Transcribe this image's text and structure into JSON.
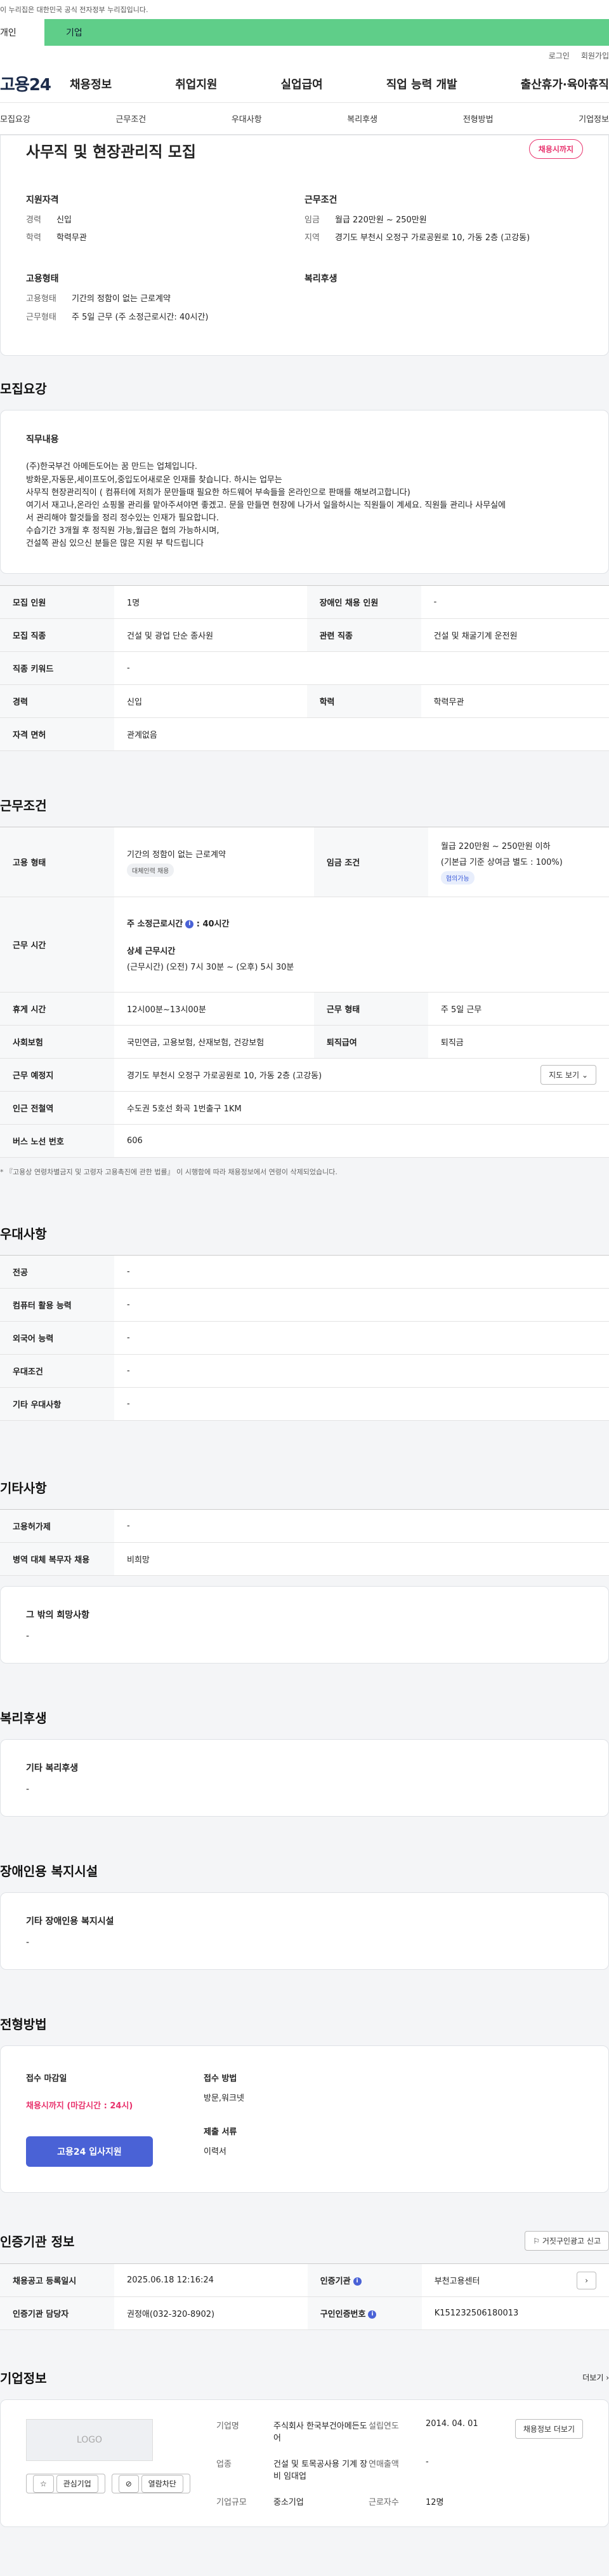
{
  "banner": "이 누리집은 대한민국 공식 전자정부 누리집입니다.",
  "tabs": [
    "개인",
    "기업"
  ],
  "util": [
    "로그인",
    "회원가입"
  ],
  "logo": "고용24",
  "gnb": [
    "채용정보",
    "취업지원",
    "실업급여",
    "직업 능력 개발",
    "출산휴가·육아휴직"
  ],
  "subnav": [
    "모집요강",
    "근무조건",
    "우대사항",
    "복리후생",
    "전형방법",
    "기업정보"
  ],
  "hero": {
    "title": "사무직 및 현장관리직 모집",
    "status": "채용시까지",
    "qual_title": "지원자격",
    "qual": [
      {
        "k": "경력",
        "v": "신입"
      },
      {
        "k": "학력",
        "v": "학력무관"
      }
    ],
    "cond_title": "근무조건",
    "cond": [
      {
        "k": "임금",
        "v": "월급 220만원 ~ 250만원"
      },
      {
        "k": "지역",
        "v": "경기도 부천시 오정구 가로공원로 10, 가동 2층 (고강동)"
      }
    ],
    "emp_title": "고용형태",
    "emp": [
      {
        "k": "고용형태",
        "v": "기간의 정함이 없는 근로계약"
      },
      {
        "k": "근무형태",
        "v": "주 5일 근무 (주 소정근로시간: 40시간)"
      }
    ],
    "welfare_title": "복리후생"
  },
  "recruit": {
    "title": "모집요강",
    "duty_title": "직무내용",
    "duty_lines": [
      "(주)한국부건 아메든도어는 꿈 만드는 업체입니다.",
      "방화문,자동문,세이프도어,중입도어새로운 인재를 찾습니다. 하시는 업무는",
      "사무직 현장관리직이 ( 컴퓨터에 저희가 문만들때 필요한 하드웨어 부속들을 온라인으로 판매를 해보려고합니다)",
      "여기서 재고나,온라인 쇼핑몰 관리를 맡아주셔야면 좋겠고. 문을 만들면 현장에 나가서 일을하시는 직원들이 계세요. 직원들 관리나 사무실에",
      "서 관리해야 할것들을 정리 정수있는 인재가 필요합니다.",
      "수습기간 3개월 후 정직원 가능,월급은 협의 가능하시며,",
      "건설쪽 관심 있으신 분들은 많은 지원 부 탁드립니다"
    ],
    "rows": [
      {
        "h1": "모집 인원",
        "v1": "1명",
        "h2": "장애인 채용 인원",
        "v2": "-"
      },
      {
        "h1": "모집 직종",
        "v1": "건설 및 광업 단순 종사원",
        "h2": "관련 직종",
        "v2": "건설 및 채굴기계 운전원"
      },
      {
        "h1": "직종 키워드",
        "v1": "-"
      },
      {
        "h1": "경력",
        "v1": "신입",
        "h2": "학력",
        "v2": "학력무관"
      },
      {
        "h1": "자격 면허",
        "v1": "관계없음"
      }
    ]
  },
  "work": {
    "title": "근무조건",
    "emp_h": "고용 형태",
    "emp_v": "기간의 정함이 없는 근로계약",
    "emp_pill": "대체인력 채용",
    "wage_h": "임금 조건",
    "wage_v": "월급 220만원 ~ 250만원 이하",
    "wage_sub": "(기본급 기준 상여금 별도 : 100%)",
    "wage_pill": "협의가능",
    "time_h": "근무 시간",
    "time_main": "주 소정근로시간",
    "time_main_v": ": 40시간",
    "time_detail_title": "상세 근무시간",
    "time_detail": "(근무시간) (오전) 7시 30분 ~ (오후) 5시 30분",
    "rest_h": "휴게 시간",
    "rest_v": "12시00분~13시00분",
    "form_h": "근무 형태",
    "form_v": "주 5일 근무",
    "ins_h": "사회보험",
    "ins_v": "국민연금, 고용보험, 산재보험, 건강보험",
    "retire_h": "퇴직급여",
    "retire_v": "퇴직금",
    "place_h": "근무 예정지",
    "place_v": "경기도 부천시 오정구 가로공원로 10, 가동 2층 (고강동)",
    "map_btn": "지도 보기",
    "station_h": "인근 전철역",
    "station_v": "수도권 5호선 화곡 1번출구 1KM",
    "bus_h": "버스 노선 번호",
    "bus_v": "606",
    "footnote": "* 『고용상 연령차별금지 및 고령자 고용촉진에 관한 법률』 이 시행함에 따라 채용정보에서 연령이 삭제되었습니다."
  },
  "pref": {
    "title": "우대사항",
    "rows": [
      {
        "h": "전공",
        "v": "-"
      },
      {
        "h": "컴퓨터 활용 능력",
        "v": "-"
      },
      {
        "h": "외국어 능력",
        "v": "-"
      },
      {
        "h": "우대조건",
        "v": "-"
      },
      {
        "h": "기타 우대사항",
        "v": "-"
      }
    ]
  },
  "etc": {
    "title": "기타사항",
    "rows": [
      {
        "h": "고용허가제",
        "v": "-"
      },
      {
        "h": "병역 대체 복무자 채용",
        "v": "비희망"
      }
    ],
    "box_title": "그 밖의 희망사항",
    "box_v": "-"
  },
  "welfare": {
    "title": "복리후생",
    "box_title": "기타 복리후생",
    "box_v": "-"
  },
  "disabled": {
    "title": "장애인용 복지시설",
    "box_title": "기타 장애인용 복지시설",
    "box_v": "-"
  },
  "selection": {
    "title": "전형방법",
    "deadline_title": "접수 마감일",
    "deadline": "채용시까지 (마감시간 : 24시)",
    "apply_btn": "고용24 입사지원",
    "method_title": "접수 방법",
    "method": "방문,워크넷",
    "docs_title": "제출 서류",
    "docs": "이력서"
  },
  "cert": {
    "title": "인증기관 정보",
    "report_btn": "거짓구인광고 신고",
    "r1h1": "채용공고 등록일시",
    "r1v1": "2025.06.18 12:16:24",
    "r1h2": "인증기관",
    "r1v2": "부천고용센터",
    "r2h1": "인증기관 담당자",
    "r2v1": "권정애(032-320-8902)",
    "r2h2": "구인인증번호",
    "r2v2": "K151232506180013"
  },
  "company": {
    "title": "기업정보",
    "more": "더보기",
    "logo": "LOGO",
    "fav": "관심기업",
    "block": "열람차단",
    "name_k": "기업명",
    "name_v": "주식회사 한국부건아메든도어",
    "ind_k": "업종",
    "ind_v": "건설 및 토목공사용 기계 장비 임대업",
    "size_k": "기업규모",
    "size_v": "중소기업",
    "year_k": "설립연도",
    "year_v": "2014. 04. 01",
    "sales_k": "연매출액",
    "sales_v": "-",
    "staff_k": "근로자수",
    "staff_v": "12명",
    "jobs_btn": "채용정보 더보기"
  }
}
